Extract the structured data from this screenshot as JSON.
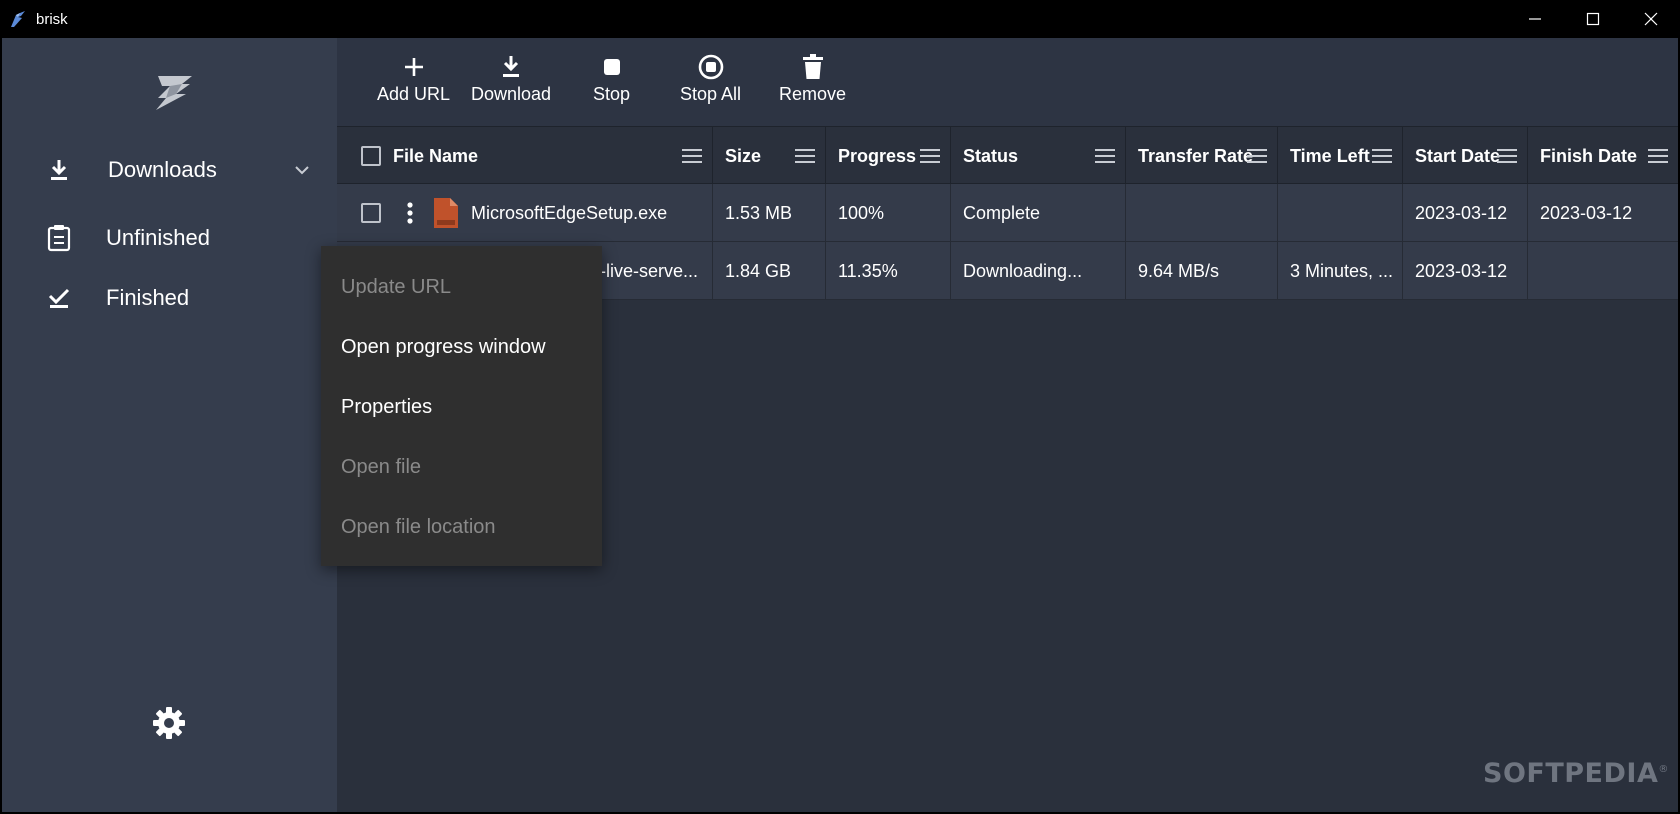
{
  "window": {
    "title": "brisk",
    "controls": [
      "minimize",
      "maximize",
      "close"
    ]
  },
  "sidebar": {
    "items": [
      {
        "label": "Downloads",
        "icon": "download-icon",
        "expanded": true
      },
      {
        "label": "Unfinished",
        "icon": "clipboard-icon"
      },
      {
        "label": "Finished",
        "icon": "check-icon"
      }
    ],
    "settings_icon": "gear-icon"
  },
  "toolbar": {
    "buttons": [
      {
        "label": "Add URL",
        "icon": "plus-icon"
      },
      {
        "label": "Download",
        "icon": "download-icon"
      },
      {
        "label": "Stop",
        "icon": "stop-icon"
      },
      {
        "label": "Stop All",
        "icon": "stop-all-icon"
      },
      {
        "label": "Remove",
        "icon": "trash-icon"
      }
    ]
  },
  "table": {
    "columns": [
      "File Name",
      "Size",
      "Progress",
      "Status",
      "Transfer Rate",
      "Time Left",
      "Start Date",
      "Finish Date"
    ],
    "rows": [
      {
        "file_name": "MicrosoftEdgeSetup.exe",
        "size": "1.53 MB",
        "progress": "100%",
        "status": "Complete",
        "transfer_rate": "",
        "time_left": "",
        "start_date": "2023-03-12",
        "finish_date": "2023-03-12"
      },
      {
        "file_name": "-live-serve...",
        "size": "1.84 GB",
        "progress": "11.35%",
        "status": "Downloading...",
        "transfer_rate": "9.64 MB/s",
        "time_left": "3 Minutes, ...",
        "start_date": "2023-03-12",
        "finish_date": ""
      }
    ]
  },
  "context_menu": {
    "items": [
      {
        "label": "Update URL",
        "enabled": false
      },
      {
        "label": "Open progress window",
        "enabled": true
      },
      {
        "label": "Properties",
        "enabled": true
      },
      {
        "label": "Open file",
        "enabled": false
      },
      {
        "label": "Open file location",
        "enabled": false
      }
    ]
  },
  "watermark": "SOFTPEDIA",
  "colors": {
    "sidebar_bg": "#353d4d",
    "main_bg": "#2a303c",
    "row_bg": "#343b4a",
    "menu_bg": "#2f2f2f",
    "file_icon": "#c0522b"
  }
}
